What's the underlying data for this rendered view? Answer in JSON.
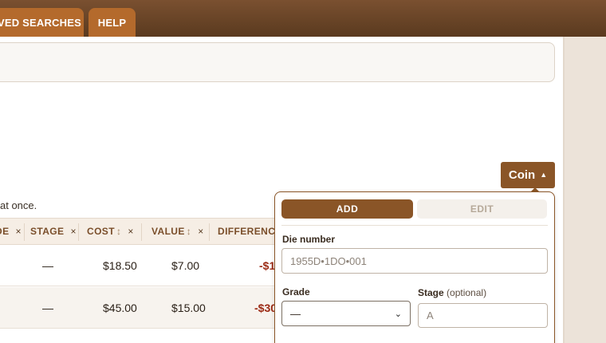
{
  "nav": {
    "tabs": [
      {
        "label": "VED SEARCHES"
      },
      {
        "label": "HELP"
      }
    ]
  },
  "toolbar": {
    "coin_label": "Coin",
    "coin_caret": "▲"
  },
  "hint_text": "at once.",
  "table": {
    "columns": [
      {
        "label": "DE",
        "close": "×"
      },
      {
        "label": "STAGE",
        "close": "×"
      },
      {
        "label": "COST",
        "sort": "↕",
        "close": "×"
      },
      {
        "label": "VALUE",
        "sort": "↕",
        "close": "×"
      },
      {
        "label": "DIFFERENCE"
      }
    ],
    "rows": [
      {
        "stage": "—",
        "cost": "$18.50",
        "value": "$7.00",
        "difference": "-$1"
      },
      {
        "stage": "—",
        "cost": "$45.00",
        "value": "$15.00",
        "difference": "-$30"
      }
    ]
  },
  "popover": {
    "add_label": "ADD",
    "edit_label": "EDIT",
    "die_number": {
      "label": "Die number",
      "placeholder": "1955D•1DO•001"
    },
    "grade": {
      "label": "Grade",
      "value": "—"
    },
    "stage": {
      "label": "Stage",
      "optional": "(optional)",
      "placeholder": "A"
    }
  },
  "colors": {
    "brand": "#8a5527",
    "tab": "#b46a2c",
    "header_bg": "#5a3a1f",
    "negative": "#9b2a14"
  }
}
